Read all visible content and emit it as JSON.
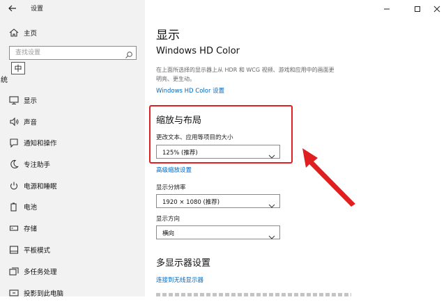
{
  "window": {
    "title": "设置",
    "back_icon": "back-arrow-icon",
    "controls": [
      "minimize-icon",
      "maximize-icon",
      "close-icon"
    ]
  },
  "sidebar": {
    "home_label": "主页",
    "search_placeholder": "查找设置",
    "ime_indicator": "中",
    "section_label": "系统",
    "items": [
      {
        "label": "显示",
        "icon": "monitor-icon"
      },
      {
        "label": "声音",
        "icon": "speaker-icon"
      },
      {
        "label": "通知和操作",
        "icon": "notification-icon"
      },
      {
        "label": "专注助手",
        "icon": "moon-icon"
      },
      {
        "label": "电源和睡眠",
        "icon": "power-icon"
      },
      {
        "label": "电池",
        "icon": "battery-icon"
      },
      {
        "label": "存储",
        "icon": "storage-icon"
      },
      {
        "label": "平板模式",
        "icon": "tablet-icon"
      },
      {
        "label": "多任务处理",
        "icon": "multitask-icon"
      },
      {
        "label": "投影到此电脑",
        "icon": "projection-icon"
      }
    ]
  },
  "main": {
    "page_title": "显示",
    "hd_color": {
      "heading": "Windows HD Color",
      "description_line1": "在上面所选择的显示器上从 HDR 和 WCG 视频、游戏和应用中的画面更",
      "description_line2": "明亮、更生动。",
      "settings_link": "Windows HD Color 设置"
    },
    "scale_layout": {
      "heading": "缩放与布局",
      "text_size_label": "更改文本、应用等项目的大小",
      "scale_value": "125% (推荐)",
      "advanced_link": "高级缩放设置",
      "resolution_label": "显示分辨率",
      "resolution_value": "1920 × 1080 (推荐)",
      "orientation_label": "显示方向",
      "orientation_value": "横向"
    },
    "multi_display": {
      "heading": "多显示器设置",
      "wireless_link": "连接到无线显示器"
    }
  },
  "annotation": {
    "highlight_color": "#e02020",
    "arrow_color": "#e02020"
  }
}
